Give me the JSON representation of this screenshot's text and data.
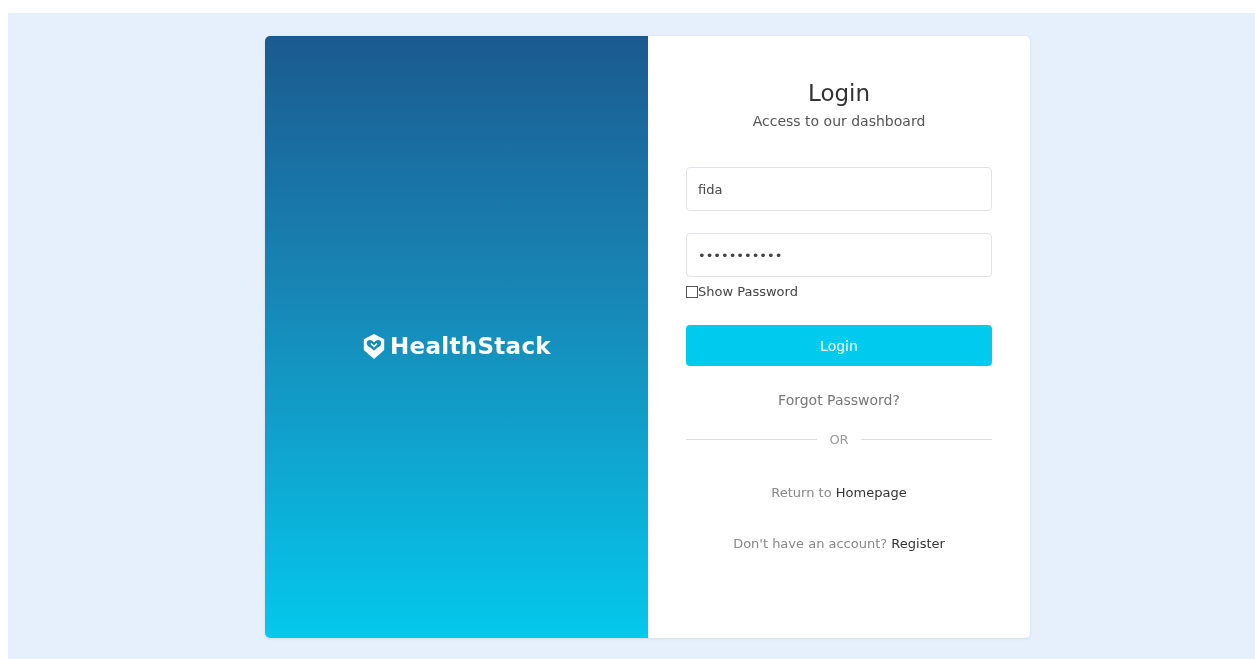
{
  "brand": {
    "name": "HealthStack"
  },
  "login": {
    "title": "Login",
    "subtitle": "Access to our dashboard",
    "username": {
      "value": "fida"
    },
    "password": {
      "value": "•••••••••••"
    },
    "show_password": {
      "label": "Show Password",
      "checked": false
    },
    "submit": "Login",
    "forgot": "Forgot Password?",
    "divider": "OR",
    "return": {
      "text": "Return to",
      "link": "Homepage"
    },
    "register": {
      "text": "Don't have an account?",
      "link": "Register"
    }
  }
}
